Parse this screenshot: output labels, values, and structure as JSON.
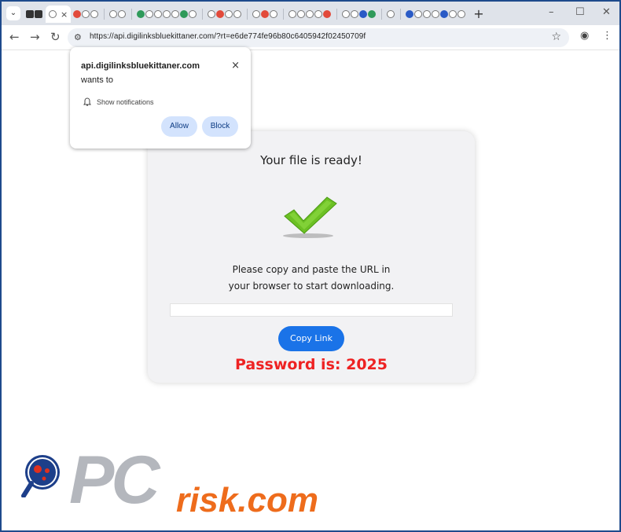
{
  "browser": {
    "url": "https://api.digilinksbluekittaner.com/?rt=e6de774fe96b80c6405942f02450709f",
    "tab_close": "×",
    "new_tab": "+",
    "window_controls": {
      "minimize": "–",
      "maximize": "☐",
      "close": "✕"
    }
  },
  "notification_popup": {
    "site": "api.digilinksbluekittaner.com",
    "wants_to": "wants to",
    "permission": "Show notifications",
    "allow_label": "Allow",
    "block_label": "Block",
    "close_glyph": "×"
  },
  "page": {
    "title": "Your file is ready!",
    "instruction_line1": "Please copy and paste the URL in",
    "instruction_line2": "your browser to start downloading.",
    "copy_button": "Copy Link",
    "password_text": "Password is: 2025"
  },
  "watermark": {
    "pc": "PC",
    "risk": "risk.com"
  },
  "colors": {
    "accent": "#1a73e8",
    "password": "#ee2222",
    "check_green": "#6cc024",
    "watermark_orange": "#ee6c1c"
  }
}
